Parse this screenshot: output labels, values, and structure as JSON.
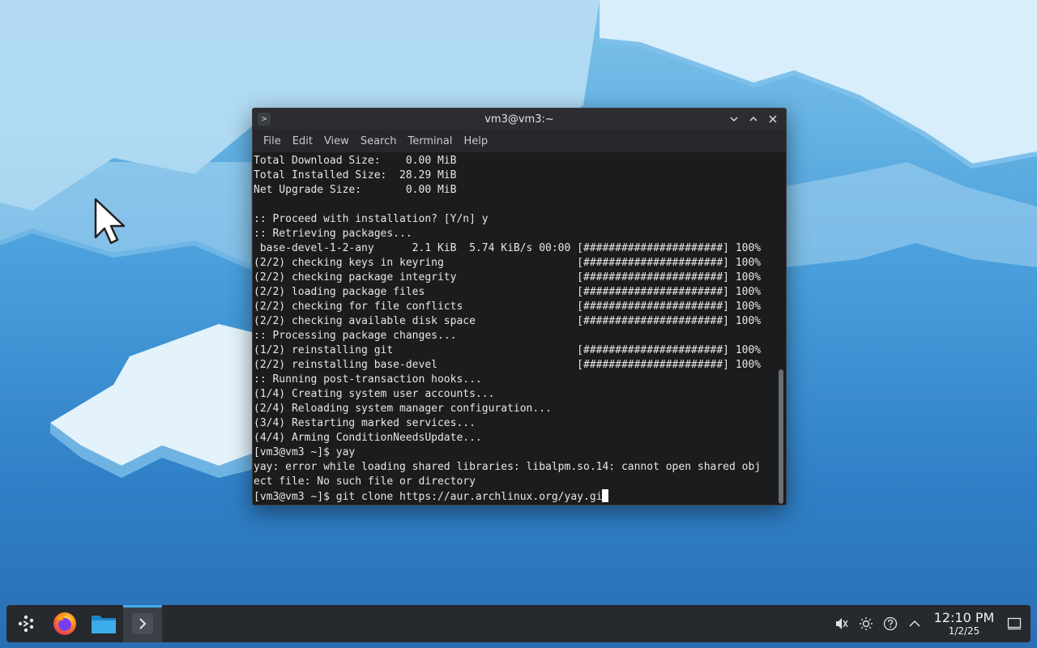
{
  "window": {
    "title": "vm3@vm3:~",
    "controls": {
      "minimize_icon": "chevron-down",
      "maximize_icon": "chevron-up",
      "close_icon": "close"
    }
  },
  "menu": {
    "items": [
      "File",
      "Edit",
      "View",
      "Search",
      "Terminal",
      "Help"
    ]
  },
  "terminal": {
    "lines": [
      "Total Download Size:    0.00 MiB",
      "Total Installed Size:  28.29 MiB",
      "Net Upgrade Size:       0.00 MiB",
      "",
      ":: Proceed with installation? [Y/n] y",
      ":: Retrieving packages...",
      " base-devel-1-2-any      2.1 KiB  5.74 KiB/s 00:00 [######################] 100%",
      "(2/2) checking keys in keyring                     [######################] 100%",
      "(2/2) checking package integrity                   [######################] 100%",
      "(2/2) loading package files                        [######################] 100%",
      "(2/2) checking for file conflicts                  [######################] 100%",
      "(2/2) checking available disk space                [######################] 100%",
      ":: Processing package changes...",
      "(1/2) reinstalling git                             [######################] 100%",
      "(2/2) reinstalling base-devel                      [######################] 100%",
      ":: Running post-transaction hooks...",
      "(1/4) Creating system user accounts...",
      "(2/4) Reloading system manager configuration...",
      "(3/4) Restarting marked services...",
      "(4/4) Arming ConditionNeedsUpdate...",
      "[vm3@vm3 ~]$ yay",
      "yay: error while loading shared libraries: libalpm.so.14: cannot open shared obj",
      "ect file: No such file or directory"
    ],
    "prompt_line": "[vm3@vm3 ~]$ git clone https://aur.archlinux.org/yay.gi"
  },
  "taskbar": {
    "apps": [
      {
        "name": "application-launcher",
        "icon": "kde-launcher-icon"
      },
      {
        "name": "firefox",
        "icon": "firefox-icon"
      },
      {
        "name": "file-manager",
        "icon": "folder-icon"
      },
      {
        "name": "terminal",
        "icon": "terminal-icon",
        "active": true
      }
    ],
    "tray": [
      "volume-muted-icon",
      "brightness-icon",
      "help-icon",
      "chevron-up-icon"
    ],
    "clock": {
      "time": "12:10 PM",
      "date": "1/2/25"
    }
  },
  "colors": {
    "accent": "#3daee9",
    "terminal_bg": "#1b1c1e",
    "terminal_fg": "#e6e6e6",
    "taskbar_bg": "#26292e"
  }
}
